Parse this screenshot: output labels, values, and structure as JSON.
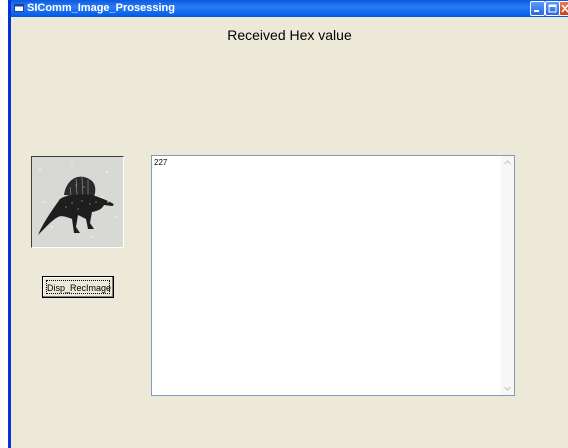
{
  "window": {
    "title": "SIComm_Image_Prosessing"
  },
  "form": {
    "heading": "Received Hex value",
    "button_label": "Disp_RecImage",
    "textbox_value": "227",
    "picture": {
      "subject": "dinosaur-image"
    }
  },
  "colors": {
    "titlebar": "#0058e6",
    "window_bg": "#ece9d8",
    "close_button": "#c9401a"
  }
}
